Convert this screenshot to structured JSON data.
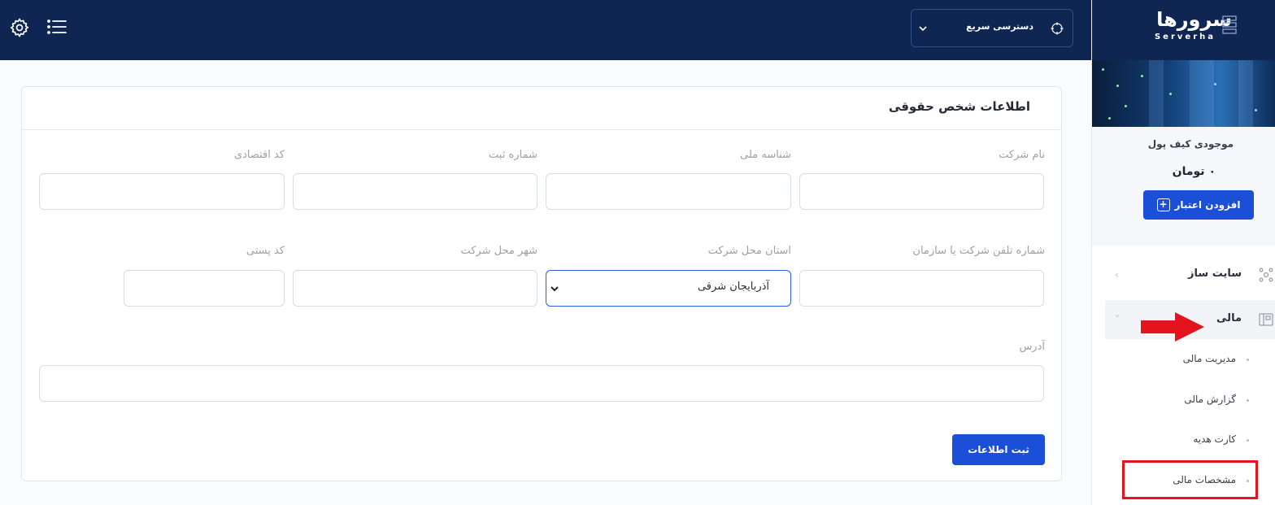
{
  "topbar": {
    "quick_access_label": "دسترسی سریع",
    "settings_icon": "gear-icon",
    "menu_icon": "hamburger-menu-icon"
  },
  "sidebar": {
    "logo_text": "سرورها",
    "logo_sub": "Serverha",
    "wallet_title": "موجودی کیف پول",
    "wallet_amount": "۰ تومان",
    "add_credit_label": "افزودن اعتبار",
    "nav": [
      {
        "label": "سایت ساز",
        "icon": "site-builder-icon"
      },
      {
        "label": "مالی",
        "icon": "finance-icon"
      }
    ],
    "sub_items": [
      {
        "label": "مدیریت مالی"
      },
      {
        "label": "گزارش مالی"
      },
      {
        "label": "کارت هدیه"
      },
      {
        "label": "مشخصات مالی"
      }
    ]
  },
  "form": {
    "title": "اطلاعات شخص حقوقی",
    "labels": {
      "company_name": "نام شرکت",
      "national_id": "شناسه ملی",
      "registration_number": "شماره ثبت",
      "economic_code": "کد اقتصادی",
      "phone": "شماره تلفن شرکت یا سازمان",
      "province": "استان محل شرکت",
      "city": "شهر محل شرکت",
      "postal_code": "کد پستی",
      "address": "آدرس"
    },
    "values": {
      "company_name": "",
      "national_id": "",
      "registration_number": "",
      "economic_code": "",
      "phone": "",
      "province": "آذربایجان شرقی",
      "city": "",
      "postal_code": "",
      "address": ""
    },
    "submit_label": "ثبت اطلاعات"
  },
  "colors": {
    "topbar_bg": "#0f2552",
    "primary": "#1c4fd8",
    "highlight": "#e3141e"
  }
}
